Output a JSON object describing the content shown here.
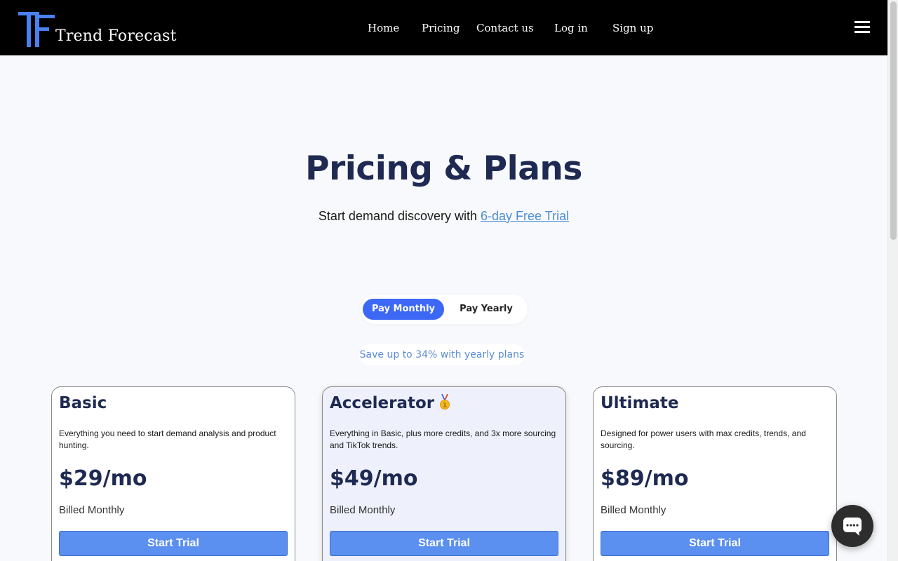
{
  "brand": {
    "name": "Trend Forecast",
    "mark": "TF"
  },
  "nav": {
    "links": [
      "Home",
      "Pricing",
      "Contact us",
      "Log in",
      "Sign up"
    ]
  },
  "hero": {
    "title": "Pricing & Plans",
    "subtitle": "Start demand discovery with ",
    "trial_link": "6-day Free Trial"
  },
  "billing_toggle": {
    "monthly": "Pay Monthly",
    "yearly": "Pay Yearly",
    "selected": "monthly"
  },
  "savings_note": "Save up to 34% with yearly plans",
  "plans": [
    {
      "name": "Basic",
      "description": "Everything you need to start demand analysis and product hunting.",
      "price": "$29/mo",
      "billing": "Billed Monthly",
      "cta": "Start Trial",
      "featured": false
    },
    {
      "name": "Accelerator",
      "description": "Everything in Basic, plus more credits,  and 3x more sourcing and TikTok trends.",
      "price": "$49/mo",
      "billing": "Billed Monthly",
      "cta": "Start Trial",
      "featured": true
    },
    {
      "name": "Ultimate",
      "description": "Designed for power users with max credits, trends, and sourcing.",
      "price": "$89/mo",
      "billing": "Billed Monthly",
      "cta": "Start Trial",
      "featured": false
    }
  ],
  "icons": {
    "menu": "hamburger-icon",
    "chat": "chat-icon",
    "medal": "gold-medal-icon"
  },
  "colors": {
    "accent": "#3d67f5",
    "button": "#5b8ff0",
    "heading": "#1e2a52",
    "link": "#4c8ed6",
    "logo": "#4a80f0"
  }
}
